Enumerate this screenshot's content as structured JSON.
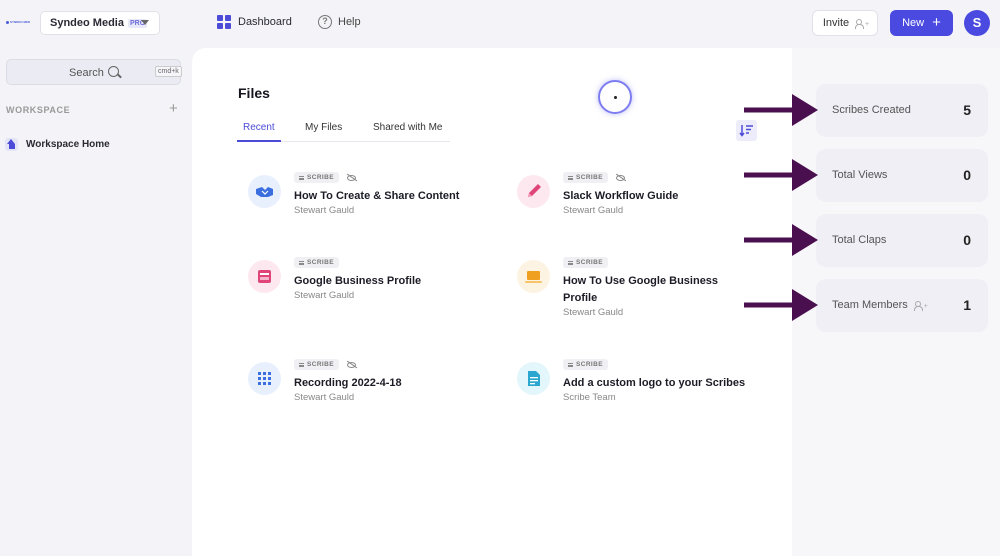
{
  "header": {
    "logo_text": "SYNDEO MEDIA",
    "org_name": "Syndeo Media",
    "org_badge": "PRO",
    "nav": [
      {
        "label": "Dashboard",
        "icon": "dashboard-grid-icon"
      },
      {
        "label": "Help",
        "icon": "help-circle-icon"
      }
    ],
    "invite_label": "Invite",
    "new_label": "New",
    "avatar_initial": "S"
  },
  "sidebar": {
    "search_label": "Search",
    "search_shortcut": "cmd+k",
    "section_label": "WORKSPACE",
    "items": [
      {
        "label": "Workspace Home",
        "icon": "home-icon"
      }
    ]
  },
  "main": {
    "title": "Files",
    "tabs": [
      {
        "label": "Recent",
        "active": true
      },
      {
        "label": "My Files",
        "active": false
      },
      {
        "label": "Shared with Me",
        "active": false
      }
    ],
    "files": [
      {
        "badge": "SCRIBE",
        "hidden": true,
        "title": "How To Create & Share Content",
        "author": "Stewart Gauld",
        "icon": "handshake-icon",
        "icon_color": "#3b6fe0",
        "icon_bg": "#e8f0fd"
      },
      {
        "badge": "SCRIBE",
        "hidden": true,
        "title": "Slack Workflow Guide",
        "author": "Stewart Gauld",
        "icon": "pencil-icon",
        "icon_color": "#e0457a",
        "icon_bg": "#fde8f0"
      },
      {
        "badge": "SCRIBE",
        "hidden": false,
        "title": "Google Business Profile",
        "author": "Stewart Gauld",
        "icon": "profile-card-icon",
        "icon_color": "#e0457a",
        "icon_bg": "#fde8f0"
      },
      {
        "badge": "SCRIBE",
        "hidden": false,
        "title": "How To Use Google Business Profile",
        "author": "Stewart Gauld",
        "icon": "laptop-icon",
        "icon_color": "#f0a020",
        "icon_bg": "#fdf3e2"
      },
      {
        "badge": "SCRIBE",
        "hidden": true,
        "title": "Recording 2022-4-18",
        "author": "Stewart Gauld",
        "icon": "grid-document-icon",
        "icon_color": "#3b6fe0",
        "icon_bg": "#e8f0fd"
      },
      {
        "badge": "SCRIBE",
        "hidden": false,
        "title": "Add a custom logo to your Scribes",
        "author": "Scribe Team",
        "icon": "document-icon",
        "icon_color": "#2aa6d0",
        "icon_bg": "#e2f6fc"
      }
    ]
  },
  "stats": [
    {
      "label": "Scribes Created",
      "value": "5"
    },
    {
      "label": "Total Views",
      "value": "0"
    },
    {
      "label": "Total Claps",
      "value": "0"
    },
    {
      "label": "Team Members",
      "value": "1",
      "icon": "add-person-icon"
    }
  ],
  "colors": {
    "accent": "#4a4ae0",
    "annotation_arrow": "#4a0f4f"
  }
}
